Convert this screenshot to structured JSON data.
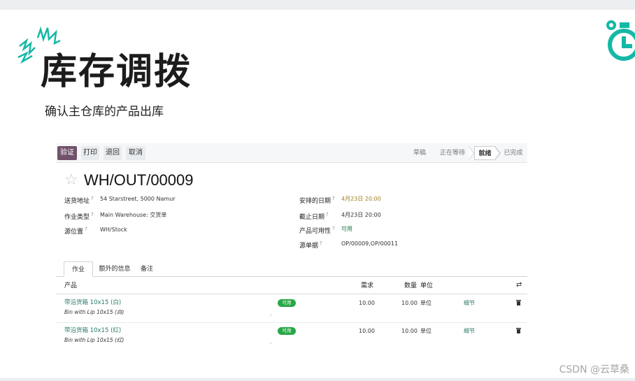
{
  "slide": {
    "title": "库存调拨",
    "subtitle": "确认主仓库的产品出库",
    "watermark": "CSDN @云草桑",
    "accent_color": "#14b8a6",
    "icons": {
      "decoration": "spark-burst-icon",
      "logo": "stopwatch-icon"
    }
  },
  "odoo": {
    "buttons": {
      "validate": "验证",
      "print": "打印",
      "return": "退回",
      "cancel": "取消"
    },
    "stages": {
      "draft": "草稿",
      "waiting": "正在等待",
      "ready": "就绪",
      "done": "已完成"
    },
    "active_stage": "就绪",
    "reference": "WH/OUT/00009",
    "fields": {
      "delivery_address": {
        "label": "送货地址",
        "hint": "?",
        "value": "54 Starstreet, 5000 Namur"
      },
      "operation_type": {
        "label": "作业类型",
        "hint": "?",
        "value": "Main Warehouse: 交货单"
      },
      "source_location": {
        "label": "源位置",
        "hint": "?",
        "value": "WH/Stock"
      },
      "scheduled_date": {
        "label": "安排的日期",
        "hint": "?",
        "value": "4月23日 20:00"
      },
      "deadline": {
        "label": "截止日期",
        "hint": "?",
        "value": "4月23日 20:00"
      },
      "availability": {
        "label": "产品可用性",
        "hint": "?",
        "value": "可用"
      },
      "source_document": {
        "label": "源单据",
        "hint": "?",
        "value": "OP/00009,OP/00011"
      }
    },
    "tabs": {
      "operations": "作业",
      "extra": "额外的信息",
      "note": "备注"
    },
    "columns": {
      "product": "产品",
      "demand": "需求",
      "quantity": "数量",
      "unit": "单位"
    },
    "rows": [
      {
        "product": "带沿货箱 10x15 (白)",
        "description": "Bin with Lip 10x15 (白)",
        "status": "可用",
        "demand": "10.00",
        "quantity": "10.00",
        "unit": "单位",
        "details": "细节"
      },
      {
        "product": "带沿货箱 10x15 (红)",
        "description": "Bin with Lip 10x15 (红)",
        "status": "可用",
        "demand": "10.00",
        "quantity": "10.00",
        "unit": "单位",
        "details": "细节"
      }
    ]
  }
}
